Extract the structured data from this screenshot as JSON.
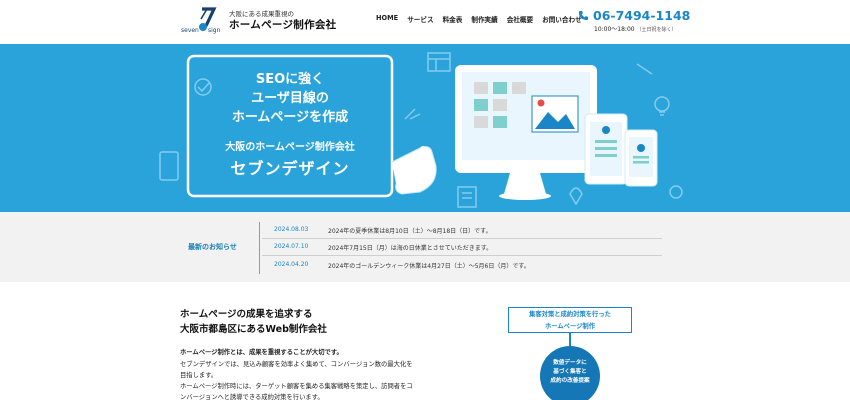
{
  "header": {
    "logo_text": "seven design",
    "tagline": "大阪にある成果重視の",
    "site_title": "ホームページ制作会社",
    "nav": [
      "HOME",
      "サービス",
      "料金表",
      "制作実績",
      "会社概要",
      "お問い合わせ"
    ],
    "phone": "06-7494-1148",
    "hours": "10:00～18:00",
    "hours_note": "（土日祝を除く）"
  },
  "hero": {
    "lines": [
      "SEOに強く",
      "ユーザ目線の",
      "ホームページを作成"
    ],
    "sub": "大阪のホームページ制作会社",
    "brand": "セブンデザイン"
  },
  "news": {
    "title": "最新のお知らせ",
    "items": [
      {
        "date": "2024.08.03",
        "text": "2024年の夏季休業は8月10日（土）～8月18日（日）です。"
      },
      {
        "date": "2024.07.10",
        "text": "2024年7月15日（月）は海の日休業とさせていただきます。"
      },
      {
        "date": "2024.04.20",
        "text": "2024年のゴールデンウィーク休業は4月27日（土）～5月6日（月）です。"
      }
    ]
  },
  "intro": {
    "heading1": "ホームページの成果を追求する",
    "heading2": "大阪市都島区にあるWeb制作会社",
    "lead": "ホームページ制作とは、成果を重視することが大切です。",
    "p1": "セブンデザインでは、見込み顧客を効率よく集めて、コンバージョン数の最大化を",
    "p2": "目指します。",
    "p3": "ホームページ制作時には、ターゲット顧客を集める集客戦略を策定し、訪問者をコ",
    "p4": "ンバージョンへと誘導できる成約対策を行います。"
  },
  "feature": {
    "box_line1": "集客対策と成約対策を行った",
    "box_line2": "ホームページ制作",
    "circle_line1": "数値データに",
    "circle_line2": "基づく集客と",
    "circle_line3": "成約の改善提案"
  },
  "colors": {
    "accent": "#1a86c8",
    "hero_bg": "#2aa3db",
    "news_bg": "#f2f2f2",
    "circle": "#1577b5"
  }
}
